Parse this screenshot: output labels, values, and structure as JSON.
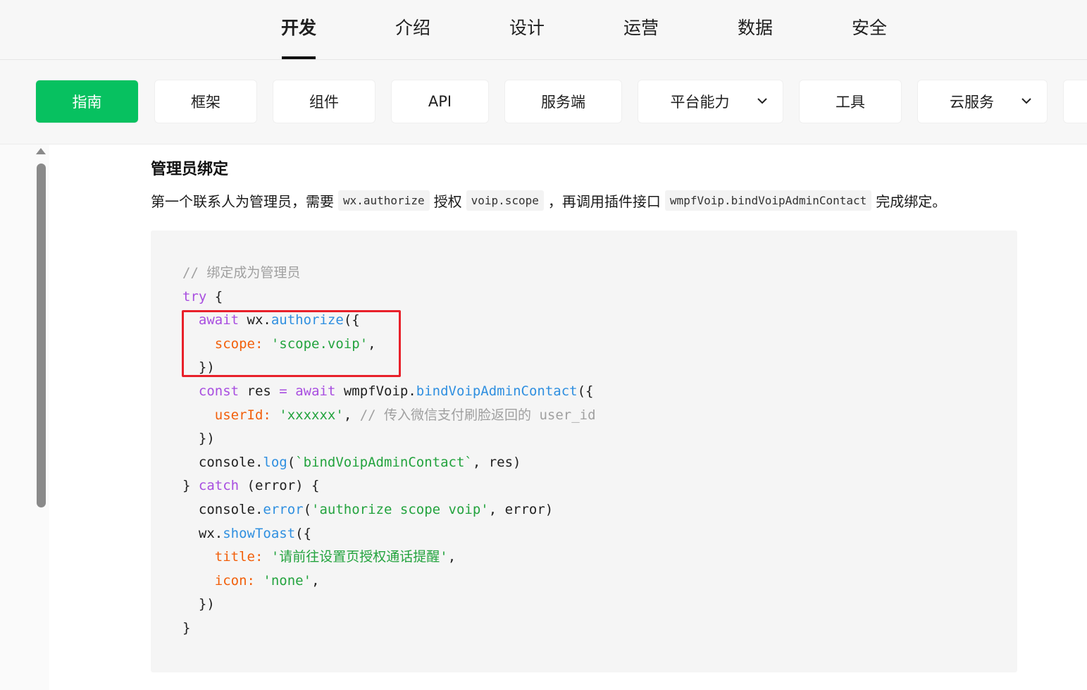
{
  "top_nav": {
    "items": [
      "开发",
      "介绍",
      "设计",
      "运营",
      "数据",
      "安全"
    ],
    "active": "开发"
  },
  "sub_nav": {
    "items": [
      {
        "label": "指南",
        "active": true
      },
      {
        "label": "框架"
      },
      {
        "label": "组件"
      },
      {
        "label": "API"
      },
      {
        "label": "服务端"
      },
      {
        "label": "平台能力",
        "dropdown": true
      },
      {
        "label": "工具"
      },
      {
        "label": "云服务",
        "dropdown": true
      }
    ],
    "active_color": "#07c160"
  },
  "section": {
    "title": "管理员绑定",
    "desc_parts": [
      "第一个联系人为管理员，需要",
      "wx.authorize",
      "授权",
      "voip.scope",
      "，再调用插件接口",
      "wmpfVoip.bindVoipAdminContact",
      "完成绑定。"
    ]
  },
  "code": {
    "comment": "// 绑定成为管理员",
    "lines": [
      "try {",
      "  await wx.authorize({",
      "    scope: 'scope.voip',",
      "  })",
      "  const res = await wmpfVoip.bindVoipAdminContact({",
      "    userId: 'xxxxxx', // 传入微信支付刷脸返回的 user_id",
      "  })",
      "  console.log(`bindVoipAdminContact`, res)",
      "} catch (error) {",
      "  console.error('authorize scope voip', error)",
      "  wx.showToast({",
      "    title: '请前往设置页授权通话提醒',",
      "    icon: 'none',",
      "  })",
      "}"
    ]
  },
  "annotation": {
    "color": "#e8202a",
    "highlighted_lines": [
      2,
      3,
      4
    ]
  },
  "colors": {
    "keyword": "#a84ee0",
    "function": "#2f8fe0",
    "property": "#f25f0a",
    "string": "#23a33e",
    "comment": "#a0a0a0"
  }
}
